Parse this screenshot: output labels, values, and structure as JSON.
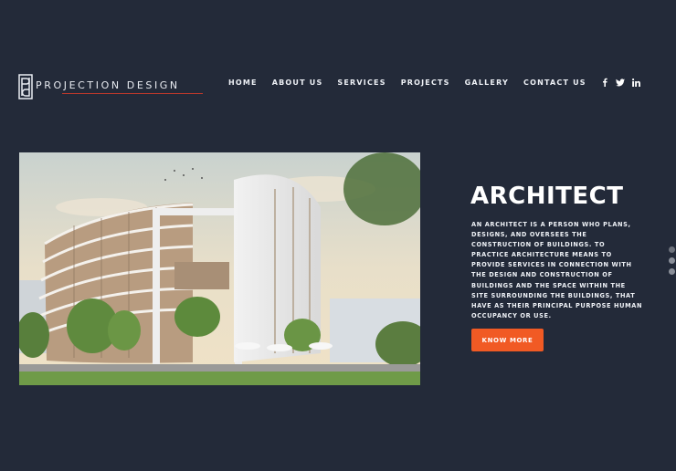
{
  "brand": {
    "name": "PROJECTION DESIGN",
    "mark": "PD",
    "accent": "#c0392b"
  },
  "nav": {
    "items": [
      "HOME",
      "ABOUT US",
      "SERVICES",
      "PROJECTS",
      "GALLERY",
      "CONTACT US"
    ],
    "social": [
      "facebook-icon",
      "twitter-icon",
      "linkedin-icon"
    ]
  },
  "hero": {
    "title": "ARCHITECT",
    "description": "An architect is a person who plans, designs, and oversees the construction of buildings. To practice architecture means to provide services in connection with the design and construction of buildings and the space within the site surrounding the buildings, that have as their principal purpose human occupancy or use.",
    "button_label": "KNOW MORE",
    "button_color": "#f15a24"
  },
  "slider": {
    "count": 3,
    "active": 1
  },
  "colors": {
    "background": "#232a39"
  }
}
